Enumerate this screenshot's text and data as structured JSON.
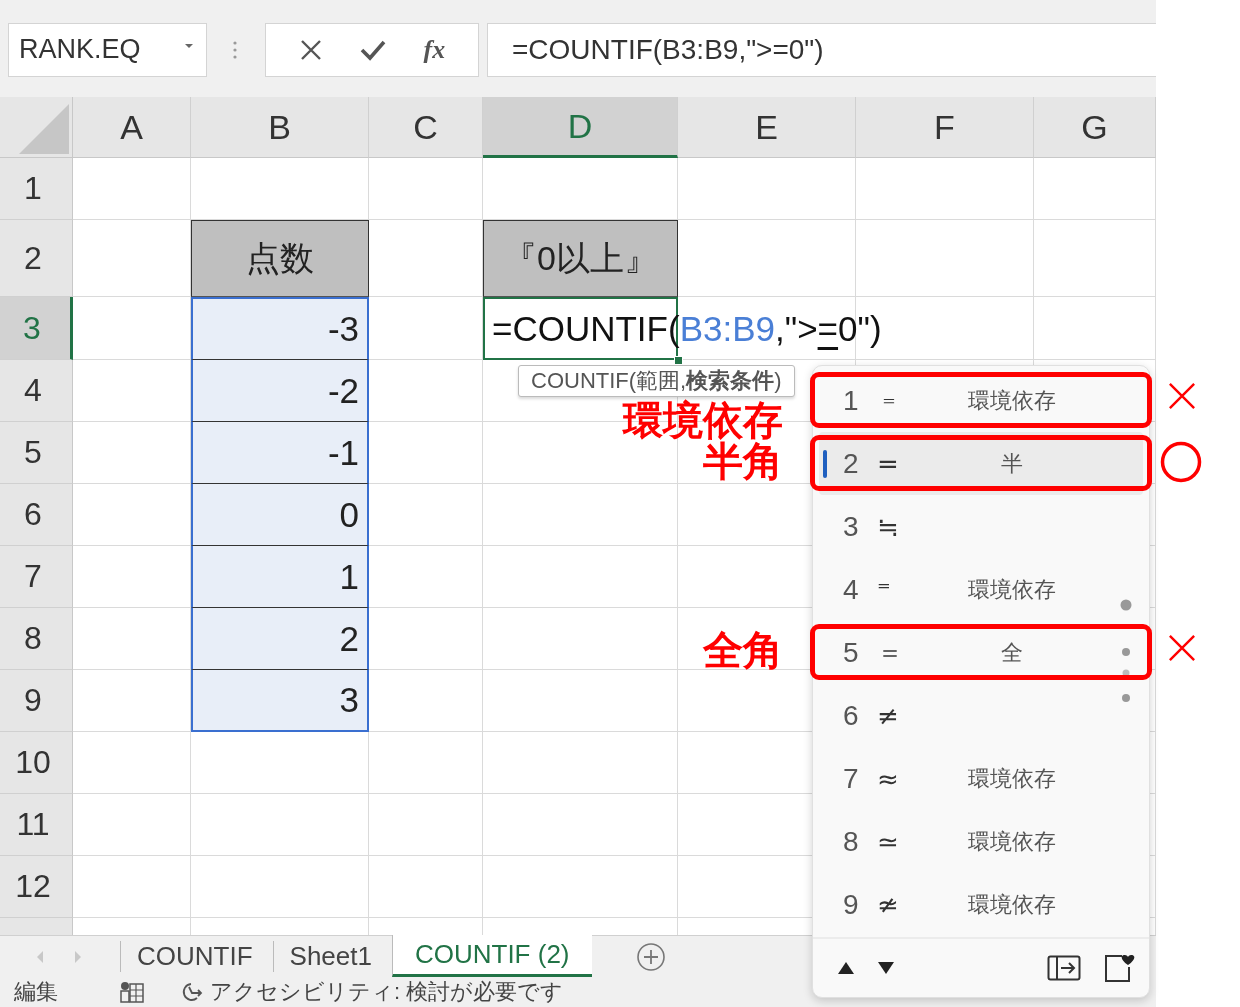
{
  "name_box": {
    "value": "RANK.EQ"
  },
  "formula_bar": {
    "fx_label": "fx",
    "value": "=COUNTIF(B3:B9,\">=0\")"
  },
  "sheet": {
    "columns": [
      {
        "label": "A",
        "selected": false
      },
      {
        "label": "B",
        "selected": false
      },
      {
        "label": "C",
        "selected": false
      },
      {
        "label": "D",
        "selected": true
      },
      {
        "label": "E",
        "selected": false
      },
      {
        "label": "F",
        "selected": false
      },
      {
        "label": "G",
        "selected": false
      }
    ],
    "rows": [
      {
        "label": "1",
        "selected": false
      },
      {
        "label": "2",
        "selected": false,
        "cells": [
          {},
          {
            "kind": "header",
            "text": "点数",
            "selected": false
          },
          {},
          {
            "kind": "header",
            "text": "『0以上』",
            "selected": false
          },
          {},
          {},
          {}
        ]
      },
      {
        "label": "3",
        "selected": true,
        "cells": [
          {},
          {
            "kind": "value",
            "text": "-3",
            "selected": true
          },
          {},
          {
            "kind": "editor",
            "selected": false,
            "segments": [
              {
                "kind": "plain",
                "text": "=COUNTIF("
              },
              {
                "kind": "reference",
                "text": "B3:B9"
              },
              {
                "kind": "plain",
                "text": ",\">"
              },
              {
                "kind": "composing",
                "text": "="
              },
              {
                "kind": "plain",
                "text": "0\")"
              }
            ]
          },
          {},
          {},
          {}
        ]
      },
      {
        "label": "4",
        "selected": false,
        "cells": [
          {},
          {
            "kind": "value",
            "text": "-2",
            "selected": true
          },
          {},
          {},
          {},
          {},
          {}
        ]
      },
      {
        "label": "5",
        "selected": false,
        "cells": [
          {},
          {
            "kind": "value",
            "text": "-1",
            "selected": true
          },
          {},
          {},
          {},
          {},
          {}
        ]
      },
      {
        "label": "6",
        "selected": false,
        "cells": [
          {},
          {
            "kind": "value",
            "text": "0",
            "selected": true
          },
          {},
          {},
          {},
          {},
          {}
        ]
      },
      {
        "label": "7",
        "selected": false,
        "cells": [
          {},
          {
            "kind": "value",
            "text": "1",
            "selected": true
          },
          {},
          {},
          {},
          {},
          {}
        ]
      },
      {
        "label": "8",
        "selected": false,
        "cells": [
          {},
          {
            "kind": "value",
            "text": "2",
            "selected": true
          },
          {},
          {},
          {},
          {},
          {}
        ]
      },
      {
        "label": "9",
        "selected": false,
        "cells": [
          {},
          {
            "kind": "value",
            "text": "3",
            "selected": true
          },
          {},
          {},
          {},
          {},
          {}
        ]
      },
      {
        "label": "10",
        "selected": false
      },
      {
        "label": "11",
        "selected": false
      },
      {
        "label": "12",
        "selected": false
      }
    ]
  },
  "function_tooltip": {
    "text": "COUNTIF(範囲,**検索条件**)"
  },
  "candidate_window": {
    "candidates": [
      {
        "number": "1",
        "symbol": "﹦",
        "note": "環境依存",
        "selected": false,
        "annotation": {
          "label": "環境依存",
          "kind": "cross"
        }
      },
      {
        "number": "2",
        "symbol": "=",
        "note": "半",
        "selected": true,
        "annotation": {
          "label": "半角",
          "kind": "circle"
        }
      },
      {
        "number": "3",
        "symbol": "≒",
        "selected": false
      },
      {
        "number": "4",
        "symbol": "⁼",
        "note": "環境依存",
        "selected": false
      },
      {
        "number": "5",
        "symbol": "＝",
        "note": "全",
        "selected": false,
        "annotation": {
          "label": "全角",
          "kind": "cross"
        }
      },
      {
        "number": "6",
        "symbol": "≠",
        "selected": false
      },
      {
        "number": "7",
        "symbol": "≈",
        "note": "環境依存",
        "selected": false
      },
      {
        "number": "8",
        "symbol": "≃",
        "note": "環境依存",
        "selected": false
      },
      {
        "number": "9",
        "symbol": "≄",
        "note": "環境依存",
        "selected": false
      }
    ]
  },
  "sheet_tabs": [
    {
      "label": "COUNTIF",
      "selected": false
    },
    {
      "label": "Sheet1",
      "selected": false
    },
    {
      "label": "COUNTIF (2)",
      "selected": true
    }
  ],
  "status_bar": {
    "mode": "編集",
    "accessibility": "アクセシビリティ: 検討が必要です"
  }
}
